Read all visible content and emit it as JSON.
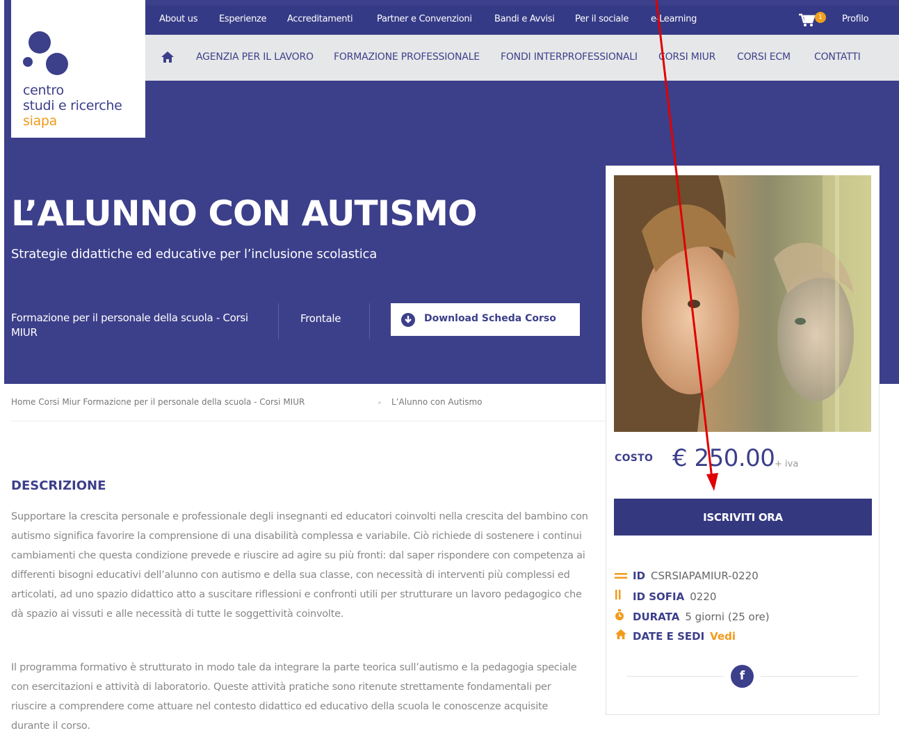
{
  "top_nav": {
    "items": [
      "About us",
      "Esperienze",
      "Accreditamenti",
      "Partner e Convenzioni",
      "Bandi e Avvisi",
      "Per il sociale",
      "e-Learning"
    ],
    "cart_count": "1",
    "profile": "Profilo"
  },
  "main_nav": {
    "items": [
      "AGENZIA PER IL LAVORO",
      "FORMAZIONE PROFESSIONALE",
      "FONDI INTERPROFESSIONALI",
      "CORSI MIUR",
      "CORSI ECM",
      "CONTATTI"
    ]
  },
  "logo": {
    "line1": "centro",
    "line2": "studi e ricerche",
    "line3": "siapa"
  },
  "hero": {
    "title": "L’ALUNNO CON AUTISMO",
    "subtitle": "Strategie didattiche ed educative per l’inclusione scolastica",
    "category": "Formazione per il personale della scuola - Corsi MIUR",
    "mode": "Frontale",
    "download_label": "Download Scheda Corso"
  },
  "breadcrumb": [
    "Home",
    "Corsi Miur",
    "Formazione per il personale della scuola - Corsi MIUR",
    "L’Alunno con Autismo"
  ],
  "description": {
    "title": "DESCRIZIONE",
    "paragraph1": "Supportare la crescita personale e professionale degli insegnanti ed educatori coinvolti nella crescita del bambino con autismo significa favorire la comprensione di una disabilità complessa e variabile. Ciò richiede di sostenere i continui cambiamenti che questa condizione prevede e riuscire ad agire su più fronti: dal saper rispondere con competenza ai differenti bisogni educativi dell’alunno con autismo e della sua classe, con necessità di interventi più complessi ed articolati, ad uno spazio didattico atto a suscitare riflessioni e confronti utili per strutturare un lavoro pedagogico che dà spazio ai vissuti e alle necessità di tutte le soggettività coinvolte.",
    "paragraph2": "Il programma formativo è strutturato in modo tale da integrare la parte teorica sull’autismo e la pedagogia speciale con esercitazioni e attività di laboratorio. Queste attività pratiche sono ritenute strettamente fondamentali per riuscire a comprendere come attuare nel contesto didattico ed educativo della scuola le conoscenze acquisite durante il corso."
  },
  "sidebar": {
    "cost_label": "COSTO",
    "price": "€ 250.00",
    "vat": "+ iva",
    "cta": "ISCRIVITI ORA",
    "id_label": "ID",
    "id_value": "CSRSIAPAMIUR-0220",
    "sofia_label": "ID SOFIA",
    "sofia_value": "0220",
    "duration_label": "DURATA",
    "duration_value": "5 giorni (25 ore)",
    "dates_label": "DATE E SEDI",
    "dates_link": "Vedi",
    "social": "f"
  },
  "colors": {
    "brand": "#3c3f8a",
    "accent": "#f29a1b",
    "annotation": "#e00000"
  }
}
